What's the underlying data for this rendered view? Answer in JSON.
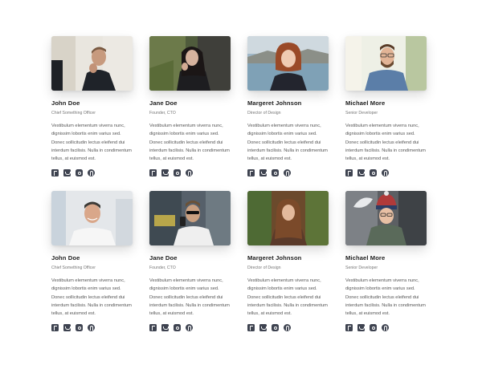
{
  "team": [
    {
      "name": "John Doe",
      "role": "Chief Something Officer",
      "bio": "Vestibulum elementum viverra nunc, dignissim lobortis enim varius sed. Donec sollicitudin lectus eleifend dui interdum facilisis. Nulla in condimentum tellus, at euismod est.",
      "photo_desc": "man in dark suit at desk",
      "social": [
        "facebook-icon",
        "twitter-icon",
        "instagram-icon",
        "pinterest-icon"
      ]
    },
    {
      "name": "Jane Doe",
      "role": "Founder, CTO",
      "bio": "Vestibulum elementum viverra nunc, dignissim lobortis enim varius sed. Donec sollicitudin lectus eleifend dui interdum facilisis. Nulla in condimentum tellus, at euismod est.",
      "photo_desc": "woman with dark hair outdoors",
      "social": [
        "facebook-icon",
        "twitter-icon",
        "instagram-icon",
        "pinterest-icon"
      ]
    },
    {
      "name": "Margeret Johnson",
      "role": "Director of Design",
      "bio": "Vestibulum elementum viverra nunc, dignissim lobortis enim varius sed. Donec sollicitudin lectus eleifend dui interdum facilisis. Nulla in condimentum tellus, at euismod est.",
      "photo_desc": "red-haired woman by water",
      "social": [
        "facebook-icon",
        "twitter-icon",
        "instagram-icon",
        "pinterest-icon"
      ]
    },
    {
      "name": "Michael More",
      "role": "Senior Developer",
      "bio": "Vestibulum elementum viverra nunc, dignissim lobortis enim varius sed. Donec sollicitudin lectus eleifend dui interdum facilisis. Nulla in condimentum tellus, at euismod est.",
      "photo_desc": "bearded man with glasses",
      "social": [
        "facebook-icon",
        "twitter-icon",
        "instagram-icon",
        "pinterest-icon"
      ]
    },
    {
      "name": "John Doe",
      "role": "Chief Something Officer",
      "bio": "Vestibulum elementum viverra nunc, dignissim lobortis enim varius sed. Donec sollicitudin lectus eleifend dui interdum facilisis. Nulla in condimentum tellus, at euismod est.",
      "photo_desc": "smiling man in white shirt",
      "social": [
        "facebook-icon",
        "twitter-icon",
        "instagram-icon",
        "pinterest-icon"
      ]
    },
    {
      "name": "Jane Doe",
      "role": "Founder, CTO",
      "bio": "Vestibulum elementum viverra nunc, dignissim lobortis enim varius sed. Donec sollicitudin lectus eleifend dui interdum facilisis. Nulla in condimentum tellus, at euismod est.",
      "photo_desc": "man with sunglasses on phone in street",
      "social": [
        "facebook-icon",
        "twitter-icon",
        "instagram-icon",
        "pinterest-icon"
      ]
    },
    {
      "name": "Margeret Johnson",
      "role": "Director of Design",
      "bio": "Vestibulum elementum viverra nunc, dignissim lobortis enim varius sed. Donec sollicitudin lectus eleifend dui interdum facilisis. Nulla in condimentum tellus, at euismod est.",
      "photo_desc": "woman with long hair in autumn forest",
      "social": [
        "facebook-icon",
        "twitter-icon",
        "instagram-icon",
        "pinterest-icon"
      ]
    },
    {
      "name": "Michael More",
      "role": "Senior Developer",
      "bio": "Vestibulum elementum viverra nunc, dignissim lobortis enim varius sed. Donec sollicitudin lectus eleifend dui interdum facilisis. Nulla in condimentum tellus, at euismod est.",
      "photo_desc": "woman in knit hat in snow",
      "social": [
        "facebook-icon",
        "twitter-icon",
        "instagram-icon",
        "pinterest-icon"
      ]
    }
  ]
}
